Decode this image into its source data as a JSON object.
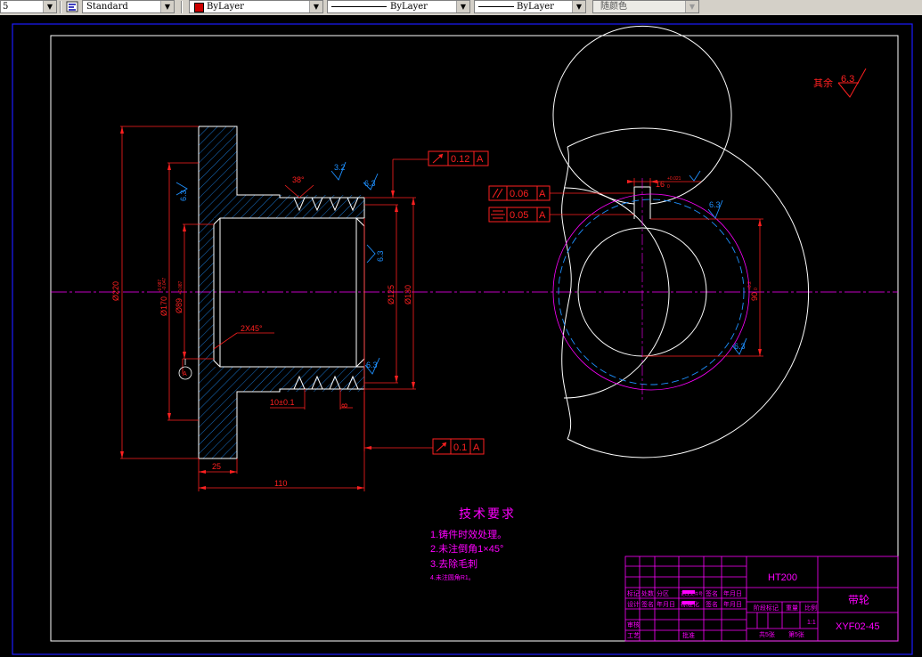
{
  "toolbar": {
    "layer_stub": "5",
    "text_style": "Standard",
    "color": "ByLayer",
    "linetype": "ByLayer",
    "lineweight": "ByLayer",
    "plot_style": "随颜色",
    "color_swatch": "#cc0000"
  },
  "drawing": {
    "roughness_default_prefix": "其余",
    "roughness_default_value": "6.3",
    "roughness_values": [
      "6.3",
      "3.2",
      "6.3",
      "6.3",
      "6.3",
      "6.3",
      "6.3"
    ],
    "dims": {
      "d220": "Ø220",
      "d170": "Ø170",
      "d170_tol": "-0.087",
      "d170_tol2": "-0.047",
      "d89": "Ø89",
      "d89_tol": "+0.087",
      "d125": "Ø125",
      "d130": "Ø130",
      "angle38": "38°",
      "chamfer": "2X45°",
      "pitch": "10±0.1",
      "groove": "8",
      "len25": "25",
      "len110": "110",
      "key_width": "16",
      "key_tol": "+0.021",
      "key_tol_lower": "0",
      "key_depth": "90",
      "key_depth_tol": "+0.2",
      "key_depth_tol_lower": "0",
      "datum": "A"
    },
    "tolerances": [
      {
        "symbol": "runout",
        "value": "0.12",
        "datum": "A"
      },
      {
        "symbol": "parallelism",
        "value": "0.06",
        "datum": "A"
      },
      {
        "symbol": "symmetry",
        "value": "0.05",
        "datum": "A"
      },
      {
        "symbol": "runout",
        "value": "0.1",
        "datum": "A"
      }
    ],
    "tech": {
      "title": "技术要求",
      "notes": [
        "1.铸件时效处理。",
        "2.未注倒角1×45°",
        "3.去除毛刺",
        "4.未注圆角R1。"
      ]
    },
    "title_block": {
      "material": "HT200",
      "part_name": "带轮",
      "drawing_no": "XYF02-45",
      "scale": "1:1",
      "sheet_total": "共5张",
      "sheet_no": "第5张",
      "row_labels": [
        "标记",
        "设计",
        "审核",
        "工艺"
      ],
      "col_labels": [
        "处数",
        "分区",
        "更改文件号",
        "签名",
        "年月日"
      ],
      "small_labels": [
        "标准化",
        "批准",
        "阶段标记",
        "重量",
        "比例"
      ]
    }
  }
}
